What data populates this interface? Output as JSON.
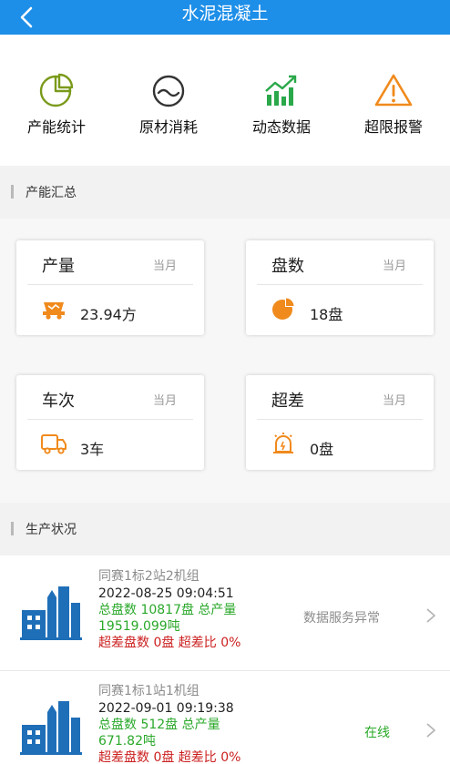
{
  "header": {
    "title": "水泥混凝土",
    "back_icon": "chevron-left-icon"
  },
  "quick_actions": [
    {
      "label": "产能统计",
      "icon": "pie-chart-icon",
      "color": "#7a9a1a"
    },
    {
      "label": "原材消耗",
      "icon": "bowl-wave-icon",
      "color": "#333333"
    },
    {
      "label": "动态数据",
      "icon": "trend-chart-icon",
      "color": "#2aa84a"
    },
    {
      "label": "超限报警",
      "icon": "warning-triangle-icon",
      "color": "#f08a1c"
    }
  ],
  "summary_section": {
    "title": "产能汇总"
  },
  "summary_cards": [
    {
      "name": "产量",
      "period": "当月",
      "value": "23.94方",
      "icon": "mixer-truck-icon"
    },
    {
      "name": "盘数",
      "period": "当月",
      "value": "18盘",
      "icon": "pie-icon"
    },
    {
      "name": "车次",
      "period": "当月",
      "value": "3车",
      "icon": "truck-icon"
    },
    {
      "name": "超差",
      "period": "当月",
      "value": "0盘",
      "icon": "alarm-icon"
    }
  ],
  "production_section": {
    "title": "生产状况"
  },
  "stations": [
    {
      "name": "同赛1标2站2机组",
      "time": "2022-08-25 09:04:51",
      "totals": "总盘数 10817盘 总产量",
      "output": "19519.099吨",
      "over": "超差盘数 0盘 超差比 0%",
      "status": "数据服务异常",
      "status_color": "#8c8c8c"
    },
    {
      "name": "同赛1标1站1机组",
      "time": "2022-09-01 09:19:38",
      "totals": "总盘数 512盘 总产量",
      "output": "671.82吨",
      "over": "超差盘数 0盘 超差比 0%",
      "status": "在线",
      "status_color": "#2aa82a"
    }
  ],
  "colors": {
    "header": "#1e8fe8",
    "accent_orange": "#f08a1c",
    "green": "#2aa82a",
    "red": "#cc2020",
    "building": "#1f6fb8"
  }
}
